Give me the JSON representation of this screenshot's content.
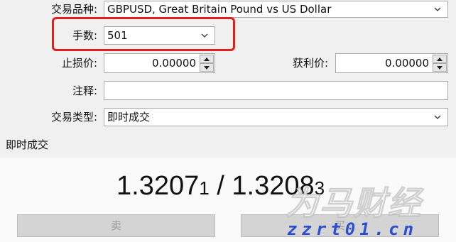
{
  "form": {
    "symbol_label": "交易品种:",
    "symbol_value": "GBPUSD, Great Britain Pound vs US Dollar",
    "volume_label": "手数:",
    "volume_value": "501",
    "stoploss_label": "止损价:",
    "stoploss_value": "0.00000",
    "takeprofit_label": "获利价:",
    "takeprofit_value": "0.00000",
    "comment_label": "注释:",
    "comment_value": "",
    "type_label": "交易类型:",
    "type_value": "即时成交"
  },
  "quote": {
    "section_title": "即时成交",
    "bid_main": "1.3207",
    "bid_small": "1",
    "separator": " / ",
    "ask_main": "1.3208",
    "ask_small": "3"
  },
  "buttons": {
    "sell": "卖",
    "buy": "买"
  },
  "watermark": {
    "brand": "为马财经",
    "url": "zzrt01.cn"
  },
  "colors": {
    "highlight": "#e0211b"
  }
}
